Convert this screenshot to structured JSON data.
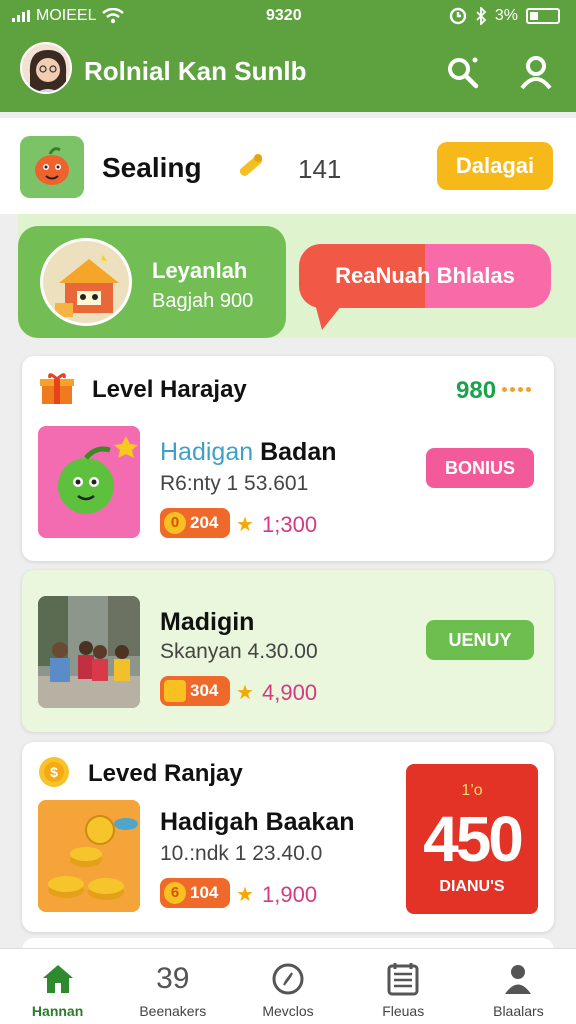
{
  "status_bar": {
    "carrier": "MOIEEL",
    "time": "9320",
    "battery": "3%"
  },
  "header": {
    "title": "Rolnial Kan Sunlb"
  },
  "filter": {
    "label": "Sealing",
    "count": "141",
    "button": "Dalagai"
  },
  "promo": {
    "title": "Leyanlah",
    "subtitle": "Bagjah 900",
    "bubble": "ReaNuah Bhlalas"
  },
  "sections": [
    {
      "heading": "Level Harajay",
      "score": "980",
      "item": {
        "title_accent": "Hadigan",
        "title_main": " Badan",
        "subtitle": "R6:nty 1 53.601",
        "coin": "204",
        "coin_glyph": "0",
        "price": "1;300",
        "badge": "BONIUS"
      }
    },
    {
      "item": {
        "title": "Madigin",
        "subtitle": "Skanyan 4.30.00",
        "coin": "304",
        "price": "4,900",
        "badge": "UENUY"
      }
    },
    {
      "heading": "Leved Ranjay",
      "item": {
        "title": "Hadigah Baakan",
        "subtitle": "10.:ndk 1 23.40.0",
        "coin": "104",
        "coin_glyph": "6",
        "price": "1,900"
      },
      "bonus_card": {
        "small": "1’o",
        "value": "450",
        "label": "DIANU'S"
      }
    }
  ],
  "bottom_nav": [
    {
      "label": "Hannan",
      "icon": "home-icon",
      "active": true
    },
    {
      "label": "Beenakers",
      "icon": "sales-icon",
      "display": "39"
    },
    {
      "label": "Mevclos",
      "icon": "compass-icon"
    },
    {
      "label": "Fleuas",
      "icon": "list-icon"
    },
    {
      "label": "Blaalars",
      "icon": "person-icon"
    }
  ],
  "colors": {
    "primary_green": "#5da23e",
    "accent_yellow": "#f7b81a",
    "bonus_pink": "#f25a9a",
    "bonus_red": "#e33327",
    "price_magenta": "#d43a82",
    "score_green": "#1aa34a"
  }
}
